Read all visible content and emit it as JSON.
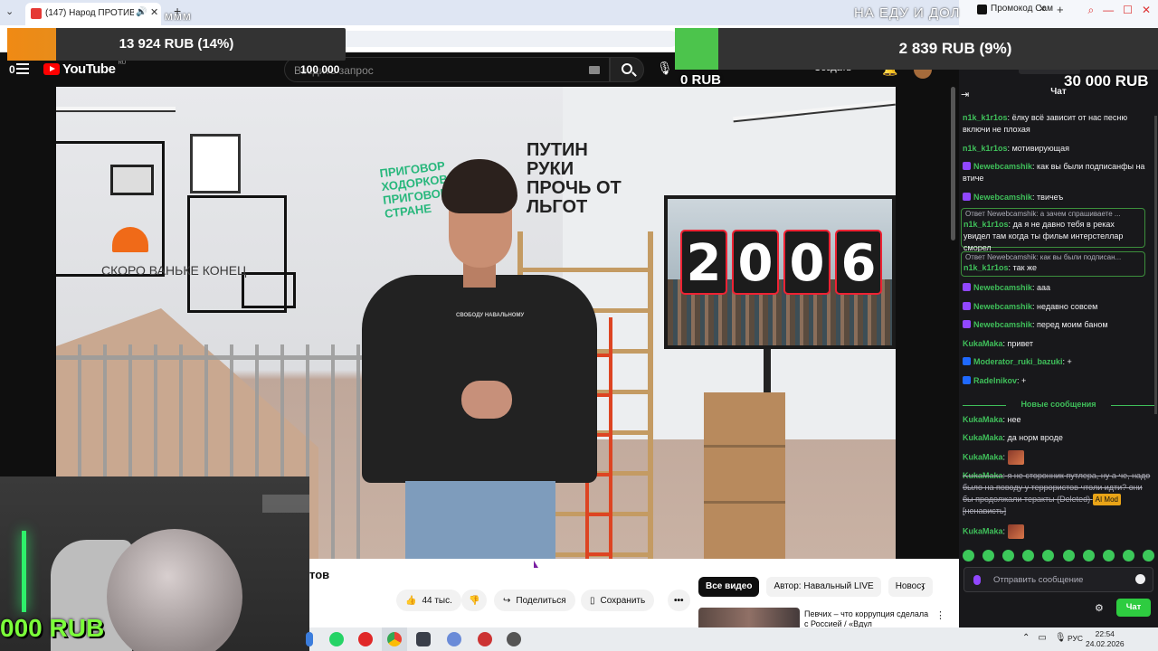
{
  "browser": {
    "tab_title": "(147) Народ ПРОТИВ Пути",
    "second_tab_title": "Промокод Сам"
  },
  "youtube": {
    "logo_text": "YouTube",
    "region": "RU",
    "search_placeholder": "Введите запрос",
    "create_label": "+ Создать",
    "video_title_fragment": "тов",
    "like_count": "44 тыс.",
    "share_label": "Поделиться",
    "save_label": "Сохранить",
    "more_label": "•••",
    "chips": [
      "Все видео",
      "Автор: Навальный LIVE",
      "Новост"
    ],
    "rec_title": "Певчих – что коррупция сделала с Россией / «Вдул",
    "channel_logo": "HL"
  },
  "video_scene": {
    "graffiti_green": "ПРИГОВОР ХОДОРКОВСКОГО ПРИГОВОР ВСЕЙ СТРАНЕ",
    "graffiti_black": "ПУТИН РУКИ ПРОЧЬ ОТ ЛЬГОТ",
    "graffiti_grey": "СКОРО ВАНЬКЕ КОНЕЦ",
    "year": [
      "2",
      "0",
      "0",
      "6"
    ],
    "shirt_text": "СВОБОДУ НАВАЛЬНОМУ"
  },
  "overlays": {
    "goal_left": "13 924 RUB (14%)",
    "goal_left_percent": 14,
    "goal_right": "2 839 RUB (9%)",
    "goal_right_percent": 9,
    "label_100k": "100 000",
    "label_0rub": "0 RUB",
    "label_30k": "30 000 RUB",
    "label_0": "0",
    "ticker_a": "ммм",
    "ticker_b": "НА ЕДУ И ДОЛ",
    "webcam_rub": "000 RUB"
  },
  "chat": {
    "header": "Чат",
    "messages": [
      {
        "user": "n1k_k1r1os",
        "text": "ёлку всё зависит от нас песню включи не плохая",
        "user_color": "#3fbf5a",
        "badge": ""
      },
      {
        "user": "n1k_k1r1os",
        "text": "мотивирующая",
        "user_color": "#3fbf5a",
        "badge": ""
      },
      {
        "user": "Newebcamshik",
        "text": "как вы были подписанфы на втиче",
        "user_color": "#3fbf5a",
        "badge": "mic"
      },
      {
        "user": "Newebcamshik",
        "text": "твичеъ",
        "user_color": "#3fbf5a",
        "badge": "mic"
      },
      {
        "reply": "Ответ Newebcamshik: а зачем спрашиваете ...",
        "user": "n1k_k1r1os",
        "text": "да я не давно тебя в реках увидел там когда ты фильм интерстеллар сморел",
        "user_color": "#3fbf5a",
        "badge": ""
      },
      {
        "reply": "Ответ Newebcamshik: как вы были подписан...",
        "user": "n1k_k1r1os",
        "text": "так же",
        "user_color": "#3fbf5a",
        "badge": ""
      },
      {
        "user": "Newebcamshik",
        "text": "ааа",
        "user_color": "#3fbf5a",
        "badge": "mic"
      },
      {
        "user": "Newebcamshik",
        "text": "недавно совсем",
        "user_color": "#3fbf5a",
        "badge": "mic"
      },
      {
        "user": "Newebcamshik",
        "text": "перед моим баном",
        "user_color": "#3fbf5a",
        "badge": "mic"
      },
      {
        "user": "KukaMaka",
        "text": "привет",
        "user_color": "#3fbf5a",
        "badge": ""
      },
      {
        "user": "Moderator_ruki_bazuki",
        "text": "+",
        "user_color": "#3fbf5a",
        "badge": "mod"
      },
      {
        "user": "Radelnikov",
        "text": "+",
        "user_color": "#3fbf5a",
        "badge": "mod"
      }
    ],
    "new_messages_label": "Новые сообщения",
    "new_messages": [
      {
        "user": "KukaMaka",
        "text": "нее"
      },
      {
        "user": "KukaMaka",
        "text": "да норм вроде"
      },
      {
        "user": "KukaMaka",
        "text": ""
      },
      {
        "user": "KukaMaka",
        "text": "я не сторонник путлера, ну а че, надо было на поводу у террористов чтоли идти? они бы продолжали теракты (Deleted)",
        "tag": "AI Mod",
        "tag_note": "[ненависть]"
      },
      {
        "user": "KukaMaka",
        "text": ""
      }
    ],
    "input_placeholder": "Отправить сообщение",
    "send_label": "Чат"
  },
  "taskbar": {
    "lang": "РУС",
    "time": "22:54",
    "date": "24.02.2026"
  }
}
